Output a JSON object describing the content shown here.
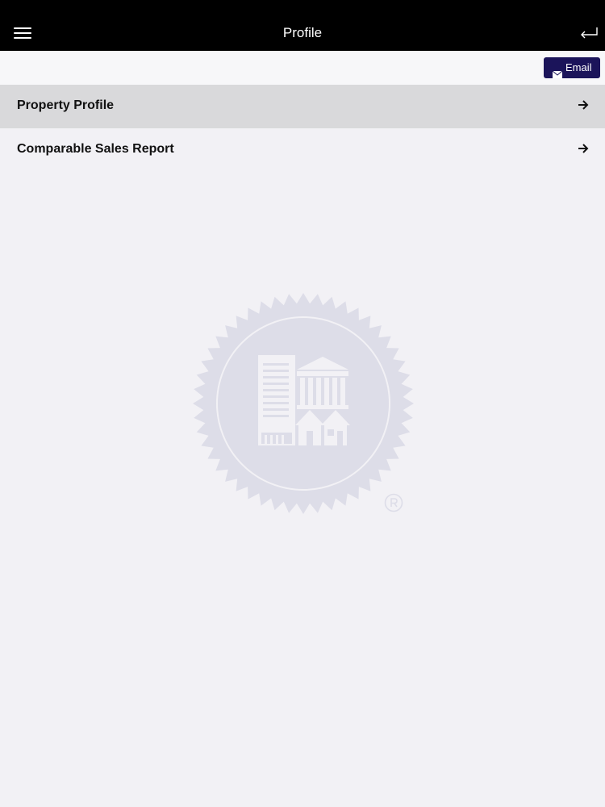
{
  "header": {
    "title": "Profile",
    "menu_icon": "hamburger-menu-icon",
    "back_icon": "return-arrow-icon"
  },
  "toolbar": {
    "email_label": "Email",
    "email_icon": "envelope-icon"
  },
  "menu": {
    "items": [
      {
        "label": "Property Profile",
        "selected": true,
        "icon": "arrow-right-icon"
      },
      {
        "label": "Comparable Sales Report",
        "selected": false,
        "icon": "arrow-right-icon"
      }
    ]
  },
  "colors": {
    "navbar": "#000000",
    "background": "#f2f1f5",
    "selected_row": "#d9d9db",
    "accent": "#1b145a",
    "watermark": "#dddde8"
  }
}
